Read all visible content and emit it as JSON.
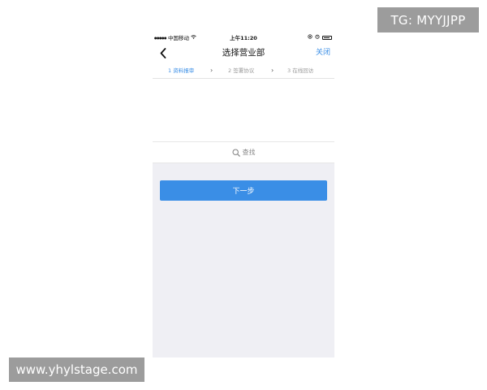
{
  "watermarks": {
    "top_right": "TG: MYYJJPP",
    "bottom_left": "www.yhylstage.com"
  },
  "status_bar": {
    "signal_dots": "●●●●●",
    "carrier": "中国移动",
    "time": "上午11:20"
  },
  "nav": {
    "title": "选择营业部",
    "close_label": "关闭"
  },
  "steps": [
    {
      "label": "1 资料报审",
      "active": true
    },
    {
      "label": "2 签署协议",
      "active": false
    },
    {
      "label": "3 在线回访",
      "active": false
    }
  ],
  "step_separator": "›",
  "search": {
    "placeholder": "查找"
  },
  "actions": {
    "next_label": "下一步"
  },
  "colors": {
    "accent": "#3a8ee6",
    "background": "#efeff4",
    "watermark": "#9c9c9c"
  }
}
